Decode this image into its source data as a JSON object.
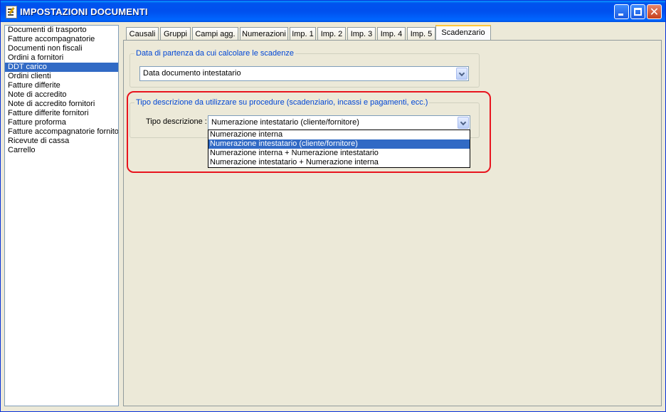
{
  "window": {
    "title": "IMPOSTAZIONI DOCUMENTI"
  },
  "titlebar_buttons": {
    "minimize_icon": "minimize-icon",
    "maximize_icon": "maximize-icon",
    "close_icon": "close-icon",
    "close_glyph": "✕"
  },
  "doc_list": {
    "items": [
      "Documenti di trasporto",
      "Fatture accompagnatorie",
      "Documenti non fiscali",
      "Ordini a fornitori",
      "DDT carico",
      "Ordini clienti",
      "Fatture differite",
      "Note di accredito",
      "Note di accredito fornitori",
      "Fatture differite fornitori",
      "Fatture proforma",
      "Fatture accompagnatorie fornitori",
      "Ricevute di cassa",
      "Carrello"
    ],
    "selected_index": 4
  },
  "tabs": [
    "Causali",
    "Gruppi",
    "Campi agg.",
    "Numerazioni",
    "Imp. 1",
    "Imp. 2",
    "Imp. 3",
    "Imp. 4",
    "Imp. 5",
    "Scadenzario"
  ],
  "active_tab": "Scadenzario",
  "group1": {
    "legend": "Data di partenza da cui calcolare le scadenze",
    "combo_value": "Data documento intestatario"
  },
  "group2": {
    "legend": "Tipo descrizione da utilizzare su procedure (scadenziario, incassi e pagamenti, ecc.)",
    "label": "Tipo descrizione :",
    "combo_value": "Numerazione intestatario (cliente/fornitore)",
    "options": [
      "Numerazione interna",
      "Numerazione intestatario (cliente/fornitore)",
      "Numerazione interna + Numerazione intestatario",
      "Numerazione intestatario + Numerazione interna"
    ],
    "highlighted_index": 1
  },
  "colors": {
    "titlebar": "#0054e3",
    "selection": "#316ac5",
    "highlight_box": "#e8141e",
    "legend_text": "#0046d5"
  }
}
